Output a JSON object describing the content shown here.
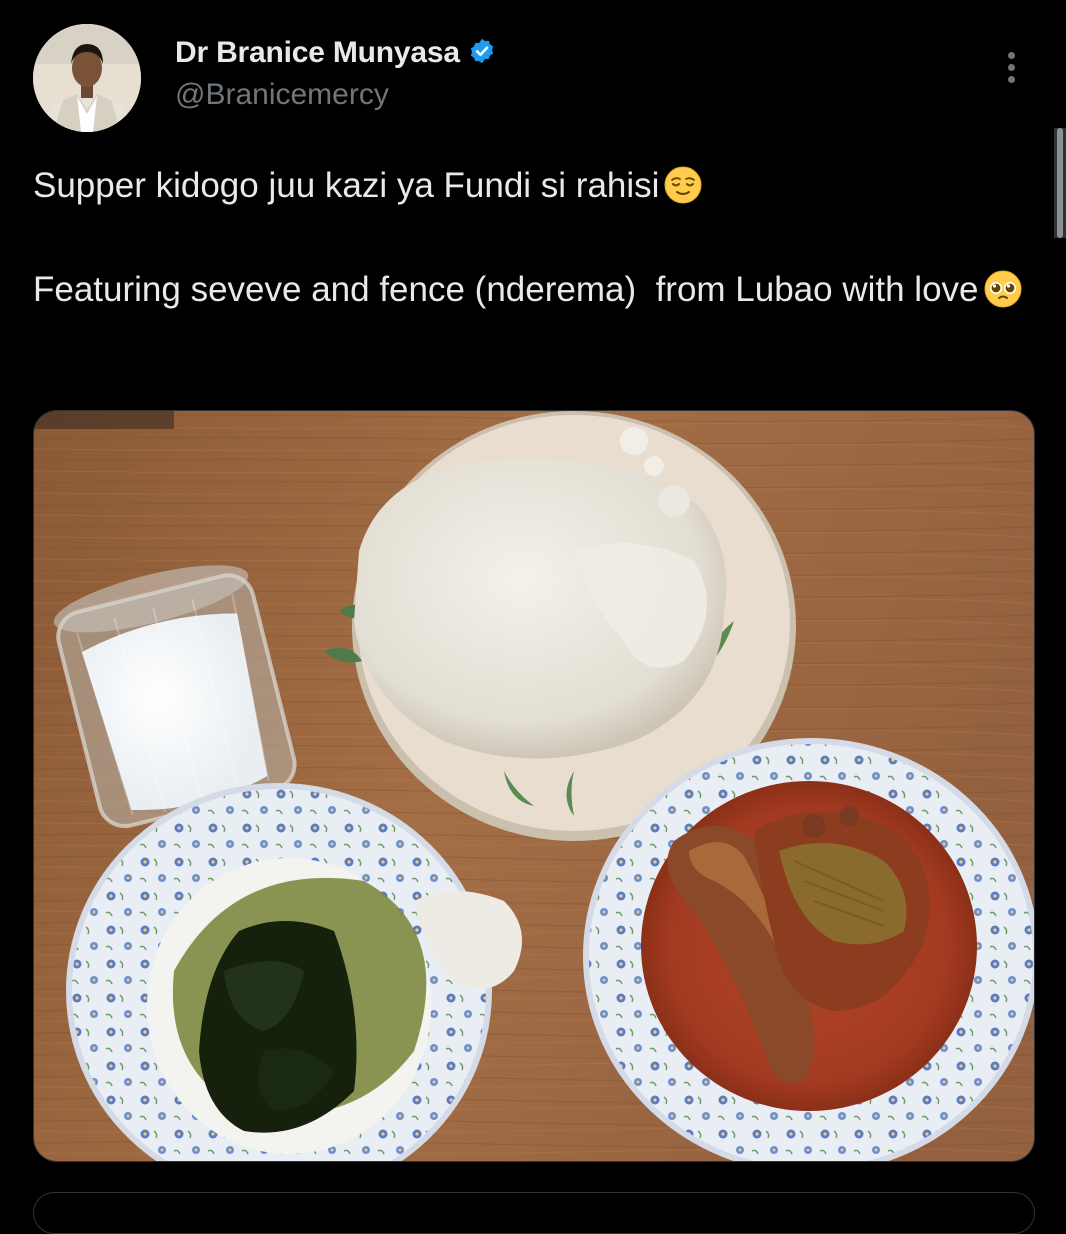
{
  "tweet": {
    "author_name": "Dr Branice Munyasa",
    "author_handle": "@Branicemercy",
    "verified": true,
    "text_line1": "Supper kidogo juu kazi ya Fundi si rahisi",
    "text_line2": "Featuring seveve and fence (nderema)  from Lubao with love",
    "emoji1": "relieved-face",
    "emoji2": "pleading-face"
  },
  "colors": {
    "background": "#000000",
    "text": "#e7e9ea",
    "muted": "#71767b",
    "verified_badge": "#1d9bf0",
    "border": "#2f3336"
  },
  "icons": {
    "more": "more-horizontal-icon",
    "verified": "verified-badge-icon"
  }
}
